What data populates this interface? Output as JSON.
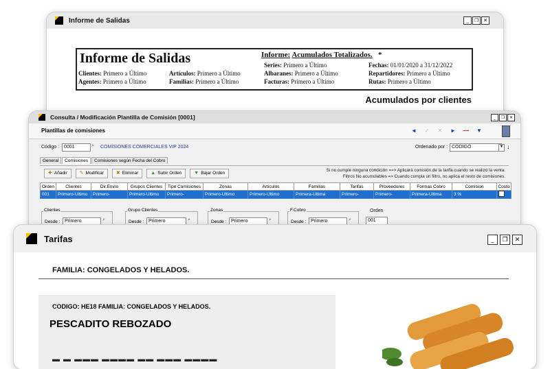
{
  "win_salidas": {
    "title": "Informe de Salidas",
    "report_title": "Informe de Salidas",
    "informe_label": "Informe:",
    "informe_value": "Acumulados Totalizados.",
    "informe_star": "*",
    "rows": [
      {
        "label": "Clientes:",
        "value": "Primero a Último"
      },
      {
        "label": "Agentes:",
        "value": "Primero a Último"
      },
      {
        "label": "Artículos:",
        "value": "Primero a Último"
      },
      {
        "label": "Familias:",
        "value": "Primero a Último"
      },
      {
        "label": "Series:",
        "value": "Primero a Último"
      },
      {
        "label": "Albaranes:",
        "value": "Primero a Último"
      },
      {
        "label": "Facturas:",
        "value": "Primero a Último"
      },
      {
        "label": "Fechas:",
        "value": "01/01/2020 a 31/12/2022"
      },
      {
        "label": "Repartidores:",
        "value": "Primero a Último"
      },
      {
        "label": "Rutas:",
        "value": "Primero a Último"
      }
    ],
    "subtitle": "Acumulados por clientes"
  },
  "win_comision": {
    "title": "Consulta / Modificación Plantilla de Comisión [0001]",
    "header": "Plantillas de comisiones",
    "codigo_label": "Código :",
    "codigo_value": "0001",
    "codigo_desc": "COMISIONES COMERCIALES VIP 2024",
    "ordenado_label": "Ordenado por :",
    "ordenado_value": "CODIGO",
    "tabs": [
      "General",
      "Comisiones",
      "Comisiones según Fecha del Cobro"
    ],
    "buttons": [
      "Añadir",
      "Modificar",
      "Eliminar",
      "Subir Orden",
      "Bajar Orden"
    ],
    "note1": "Si no cumple ninguna condición ==> Aplicará comisión de la tarifa cuando se realizó la venta.",
    "note2": "Filtros No acumulables => Cuando cumpla un filtro, no aplica el resto de comisiones.",
    "columns": [
      "Orden",
      "Clientes",
      "Dir.Envío",
      "Grupos Clientes",
      "Tipo Comisiones",
      "Zonas",
      "Articulos",
      "Familias",
      "Tarifas",
      "Proveedores",
      "Formas Cobro",
      "Comision",
      "Costo"
    ],
    "row": [
      "001",
      "Primero-Ultimo",
      "Primero-",
      "Primero-Ultimo",
      "Primero-",
      "Primero-Ultimo",
      "Primero-Ultimo",
      "Primera-Ultima",
      "Primero-",
      "Primero-",
      "Primera-Ultima",
      "3 %",
      ""
    ],
    "filters": [
      {
        "caption": "Clientes",
        "desde": "Desde :",
        "value": "Primero"
      },
      {
        "caption": "Grupo Clientes",
        "desde": "Desde :",
        "value": "Primero"
      },
      {
        "caption": "Zonas",
        "desde": "Desde :",
        "value": "Primero"
      },
      {
        "caption": "F.Cobro",
        "desde": "Desde :",
        "value": "Primero"
      }
    ],
    "orden_label": "Orden",
    "orden_value": "001"
  },
  "win_tarifas": {
    "title": "Tarifas",
    "familia_heading": "FAMILIA:  CONGELADOS Y HELADOS.",
    "card_meta": "CODIGO:  HE18     FAMILIA:  CONGELADOS Y HELADOS.",
    "product": "PESCADITO REBOZADO"
  },
  "colors": {
    "accent_yellow": "#f2c500",
    "selection_blue": "#1e6fd0"
  },
  "icons": [
    "logo-icon",
    "minimize-icon",
    "restore-icon",
    "close-icon",
    "search-icon",
    "arrow-left-icon",
    "arrow-right-icon",
    "delete-icon",
    "book-icon"
  ]
}
